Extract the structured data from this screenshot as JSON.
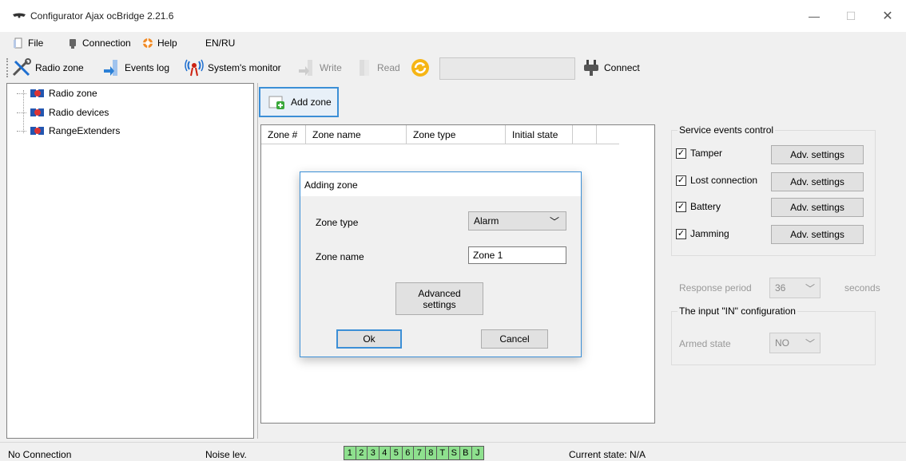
{
  "window": {
    "title": "Configurator Ajax ocBridge 2.21.6",
    "minimize_glyph": "—",
    "maximize_glyph": "☐",
    "close_glyph": "✕"
  },
  "menu": {
    "items": [
      {
        "label": "File",
        "icon": "file-icon"
      },
      {
        "label": "Connection",
        "icon": "connection-icon"
      },
      {
        "label": "Help",
        "icon": "help-icon"
      },
      {
        "label": "EN/RU",
        "icon": ""
      }
    ]
  },
  "toolbar": {
    "radio_zone": "Radio zone",
    "events_log": "Events log",
    "system_monitor": "System's monitor",
    "write": "Write",
    "read": "Read",
    "connect": "Connect"
  },
  "tree": {
    "items": [
      "Radio zone",
      "Radio devices",
      "RangeExtenders"
    ]
  },
  "main": {
    "add_zone": "Add zone",
    "grid_columns": [
      "Zone #",
      "Zone name",
      "Zone type",
      "Initial state",
      ""
    ]
  },
  "service": {
    "legend": "Service events control",
    "rows": [
      {
        "label": "Tamper",
        "checked": true,
        "button": "Adv. settings"
      },
      {
        "label": "Lost connection",
        "checked": true,
        "button": "Adv. settings"
      },
      {
        "label": "Battery",
        "checked": true,
        "button": "Adv. settings"
      },
      {
        "label": "Jamming",
        "checked": true,
        "button": "Adv. settings"
      }
    ],
    "response_label": "Response period",
    "response_value": "36",
    "response_unit": "seconds",
    "in_legend": "The input \"IN\" configuration",
    "armed_label": "Armed state",
    "armed_value": "NO"
  },
  "dialog": {
    "title": "Adding zone",
    "zone_type_label": "Zone type",
    "zone_type_value": "Alarm",
    "zone_name_label": "Zone name",
    "zone_name_value": "Zone 1",
    "advanced_line1": "Advanced",
    "advanced_line2": "settings",
    "ok": "Ok",
    "cancel": "Cancel"
  },
  "status": {
    "connection": "No Connection",
    "noise": "Noise lev.",
    "channels": [
      "1",
      "2",
      "3",
      "4",
      "5",
      "6",
      "7",
      "8",
      "T",
      "S",
      "B",
      "J"
    ],
    "current_state": "Current state:  N/A"
  },
  "colors": {
    "accent": "#3c8fd6",
    "channel_green": "#8ee08e"
  }
}
